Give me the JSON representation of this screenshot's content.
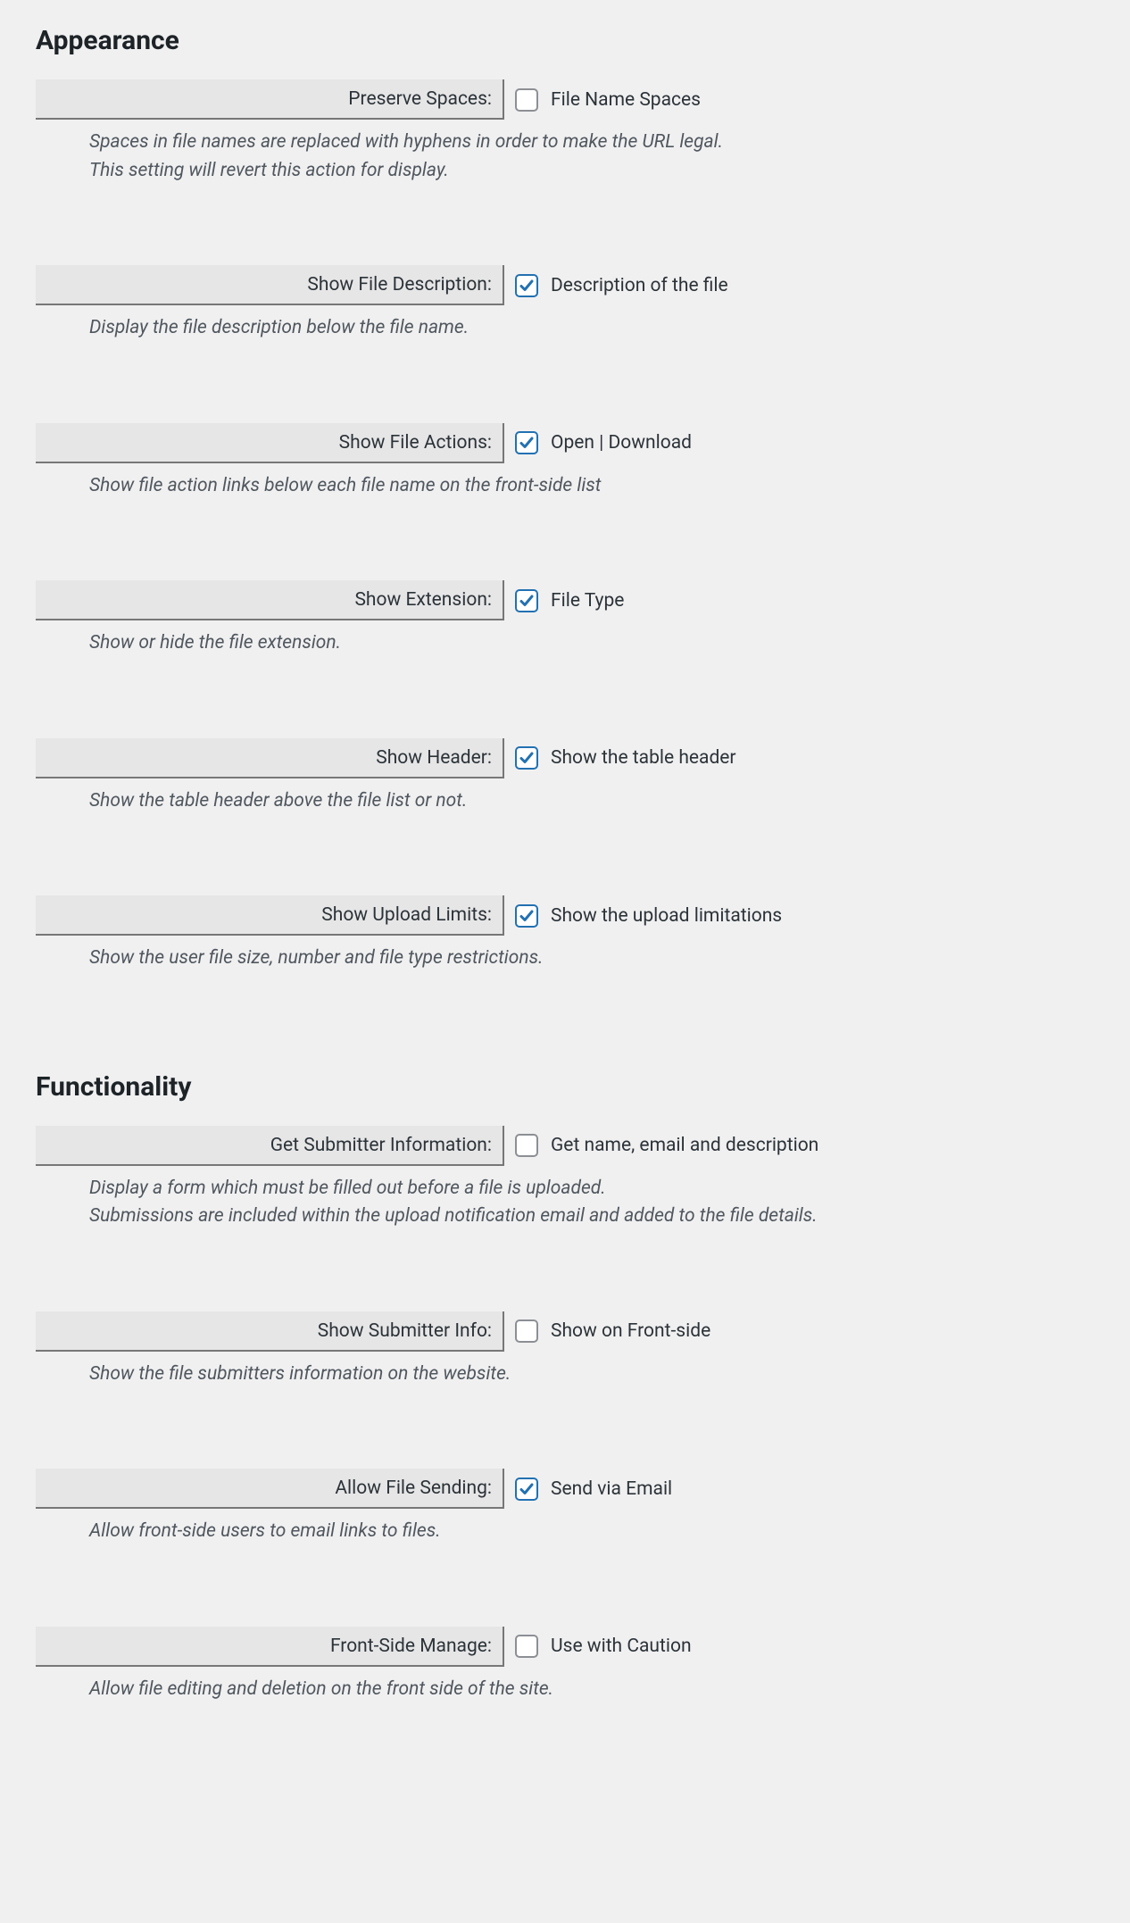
{
  "sections": [
    {
      "heading": "Appearance",
      "settings": [
        {
          "id": "preserve-spaces",
          "label": "Preserve Spaces:",
          "checked": false,
          "checkbox_label": "File Name Spaces",
          "description": "Spaces in file names are replaced with hyphens in order to make the URL legal.\nThis setting will revert this action for display."
        },
        {
          "id": "show-file-description",
          "label": "Show File Description:",
          "checked": true,
          "checkbox_label": "Description of the file",
          "description": "Display the file description below the file name."
        },
        {
          "id": "show-file-actions",
          "label": "Show File Actions:",
          "checked": true,
          "checkbox_label": "Open | Download",
          "description": "Show file action links below each file name on the front-side list"
        },
        {
          "id": "show-extension",
          "label": "Show Extension:",
          "checked": true,
          "checkbox_label": "File Type",
          "description": "Show or hide the file extension."
        },
        {
          "id": "show-header",
          "label": "Show Header:",
          "checked": true,
          "checkbox_label": "Show the table header",
          "description": "Show the table header above the file list or not."
        },
        {
          "id": "show-upload-limits",
          "label": "Show Upload Limits:",
          "checked": true,
          "checkbox_label": "Show the upload limitations",
          "description": "Show the user file size, number and file type restrictions."
        }
      ]
    },
    {
      "heading": "Functionality",
      "settings": [
        {
          "id": "get-submitter-information",
          "label": "Get Submitter Information:",
          "checked": false,
          "checkbox_label": "Get name, email and description",
          "description": "Display a form which must be filled out before a file is uploaded.\nSubmissions are included within the upload notification email and added to the file details."
        },
        {
          "id": "show-submitter-info",
          "label": "Show Submitter Info:",
          "checked": false,
          "checkbox_label": "Show on Front-side",
          "description": "Show the file submitters information on the website."
        },
        {
          "id": "allow-file-sending",
          "label": "Allow File Sending:",
          "checked": true,
          "checkbox_label": "Send via Email",
          "description": "Allow front-side users to email links to files."
        },
        {
          "id": "front-side-manage",
          "label": "Front-Side Manage:",
          "checked": false,
          "checkbox_label": "Use with Caution",
          "description": "Allow file editing and deletion on the front side of the site."
        }
      ]
    }
  ]
}
